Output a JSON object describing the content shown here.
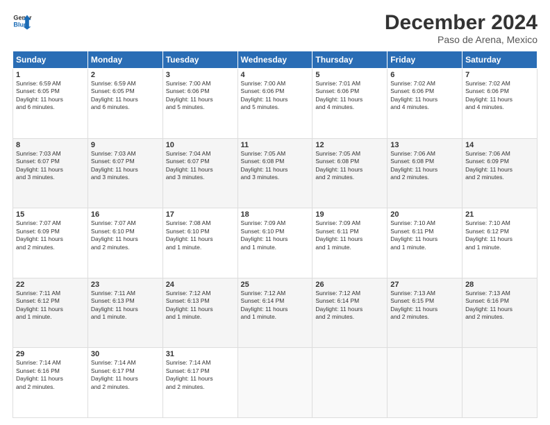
{
  "header": {
    "logo_line1": "General",
    "logo_line2": "Blue",
    "month": "December 2024",
    "location": "Paso de Arena, Mexico"
  },
  "days_of_week": [
    "Sunday",
    "Monday",
    "Tuesday",
    "Wednesday",
    "Thursday",
    "Friday",
    "Saturday"
  ],
  "rows": [
    [
      {
        "day": "1",
        "lines": [
          "Sunrise: 6:59 AM",
          "Sunset: 6:05 PM",
          "Daylight: 11 hours",
          "and 6 minutes."
        ]
      },
      {
        "day": "2",
        "lines": [
          "Sunrise: 6:59 AM",
          "Sunset: 6:05 PM",
          "Daylight: 11 hours",
          "and 6 minutes."
        ]
      },
      {
        "day": "3",
        "lines": [
          "Sunrise: 7:00 AM",
          "Sunset: 6:06 PM",
          "Daylight: 11 hours",
          "and 5 minutes."
        ]
      },
      {
        "day": "4",
        "lines": [
          "Sunrise: 7:00 AM",
          "Sunset: 6:06 PM",
          "Daylight: 11 hours",
          "and 5 minutes."
        ]
      },
      {
        "day": "5",
        "lines": [
          "Sunrise: 7:01 AM",
          "Sunset: 6:06 PM",
          "Daylight: 11 hours",
          "and 4 minutes."
        ]
      },
      {
        "day": "6",
        "lines": [
          "Sunrise: 7:02 AM",
          "Sunset: 6:06 PM",
          "Daylight: 11 hours",
          "and 4 minutes."
        ]
      },
      {
        "day": "7",
        "lines": [
          "Sunrise: 7:02 AM",
          "Sunset: 6:06 PM",
          "Daylight: 11 hours",
          "and 4 minutes."
        ]
      }
    ],
    [
      {
        "day": "8",
        "lines": [
          "Sunrise: 7:03 AM",
          "Sunset: 6:07 PM",
          "Daylight: 11 hours",
          "and 3 minutes."
        ]
      },
      {
        "day": "9",
        "lines": [
          "Sunrise: 7:03 AM",
          "Sunset: 6:07 PM",
          "Daylight: 11 hours",
          "and 3 minutes."
        ]
      },
      {
        "day": "10",
        "lines": [
          "Sunrise: 7:04 AM",
          "Sunset: 6:07 PM",
          "Daylight: 11 hours",
          "and 3 minutes."
        ]
      },
      {
        "day": "11",
        "lines": [
          "Sunrise: 7:05 AM",
          "Sunset: 6:08 PM",
          "Daylight: 11 hours",
          "and 3 minutes."
        ]
      },
      {
        "day": "12",
        "lines": [
          "Sunrise: 7:05 AM",
          "Sunset: 6:08 PM",
          "Daylight: 11 hours",
          "and 2 minutes."
        ]
      },
      {
        "day": "13",
        "lines": [
          "Sunrise: 7:06 AM",
          "Sunset: 6:08 PM",
          "Daylight: 11 hours",
          "and 2 minutes."
        ]
      },
      {
        "day": "14",
        "lines": [
          "Sunrise: 7:06 AM",
          "Sunset: 6:09 PM",
          "Daylight: 11 hours",
          "and 2 minutes."
        ]
      }
    ],
    [
      {
        "day": "15",
        "lines": [
          "Sunrise: 7:07 AM",
          "Sunset: 6:09 PM",
          "Daylight: 11 hours",
          "and 2 minutes."
        ]
      },
      {
        "day": "16",
        "lines": [
          "Sunrise: 7:07 AM",
          "Sunset: 6:10 PM",
          "Daylight: 11 hours",
          "and 2 minutes."
        ]
      },
      {
        "day": "17",
        "lines": [
          "Sunrise: 7:08 AM",
          "Sunset: 6:10 PM",
          "Daylight: 11 hours",
          "and 1 minute."
        ]
      },
      {
        "day": "18",
        "lines": [
          "Sunrise: 7:09 AM",
          "Sunset: 6:10 PM",
          "Daylight: 11 hours",
          "and 1 minute."
        ]
      },
      {
        "day": "19",
        "lines": [
          "Sunrise: 7:09 AM",
          "Sunset: 6:11 PM",
          "Daylight: 11 hours",
          "and 1 minute."
        ]
      },
      {
        "day": "20",
        "lines": [
          "Sunrise: 7:10 AM",
          "Sunset: 6:11 PM",
          "Daylight: 11 hours",
          "and 1 minute."
        ]
      },
      {
        "day": "21",
        "lines": [
          "Sunrise: 7:10 AM",
          "Sunset: 6:12 PM",
          "Daylight: 11 hours",
          "and 1 minute."
        ]
      }
    ],
    [
      {
        "day": "22",
        "lines": [
          "Sunrise: 7:11 AM",
          "Sunset: 6:12 PM",
          "Daylight: 11 hours",
          "and 1 minute."
        ]
      },
      {
        "day": "23",
        "lines": [
          "Sunrise: 7:11 AM",
          "Sunset: 6:13 PM",
          "Daylight: 11 hours",
          "and 1 minute."
        ]
      },
      {
        "day": "24",
        "lines": [
          "Sunrise: 7:12 AM",
          "Sunset: 6:13 PM",
          "Daylight: 11 hours",
          "and 1 minute."
        ]
      },
      {
        "day": "25",
        "lines": [
          "Sunrise: 7:12 AM",
          "Sunset: 6:14 PM",
          "Daylight: 11 hours",
          "and 1 minute."
        ]
      },
      {
        "day": "26",
        "lines": [
          "Sunrise: 7:12 AM",
          "Sunset: 6:14 PM",
          "Daylight: 11 hours",
          "and 2 minutes."
        ]
      },
      {
        "day": "27",
        "lines": [
          "Sunrise: 7:13 AM",
          "Sunset: 6:15 PM",
          "Daylight: 11 hours",
          "and 2 minutes."
        ]
      },
      {
        "day": "28",
        "lines": [
          "Sunrise: 7:13 AM",
          "Sunset: 6:16 PM",
          "Daylight: 11 hours",
          "and 2 minutes."
        ]
      }
    ],
    [
      {
        "day": "29",
        "lines": [
          "Sunrise: 7:14 AM",
          "Sunset: 6:16 PM",
          "Daylight: 11 hours",
          "and 2 minutes."
        ]
      },
      {
        "day": "30",
        "lines": [
          "Sunrise: 7:14 AM",
          "Sunset: 6:17 PM",
          "Daylight: 11 hours",
          "and 2 minutes."
        ]
      },
      {
        "day": "31",
        "lines": [
          "Sunrise: 7:14 AM",
          "Sunset: 6:17 PM",
          "Daylight: 11 hours",
          "and 2 minutes."
        ]
      },
      null,
      null,
      null,
      null
    ]
  ]
}
